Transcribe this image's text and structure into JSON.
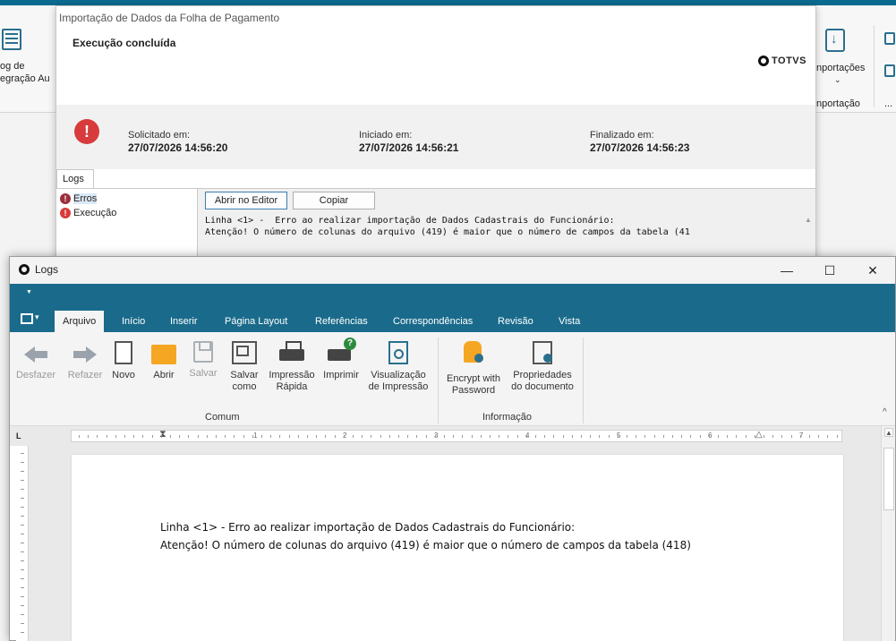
{
  "import_dialog": {
    "title": "Importação de Dados da Folha de Pagamento",
    "status": "Execução concluída",
    "brand": "TOTVS",
    "requested_label": "Solicitado em:",
    "requested_value": "27/07/2026 14:56:20",
    "started_label": "Iniciado em:",
    "started_value": "27/07/2026 14:56:21",
    "finished_label": "Finalizado em:",
    "finished_value": "27/07/2026 14:56:23",
    "tab_logs": "Logs",
    "tree": [
      "Erros",
      "Execução"
    ],
    "open_editor_label": "Abrir no Editor",
    "copy_label": "Copiar",
    "log_line1": "Linha <1> -  Erro ao realizar importação de Dados Cadastrais do Funcionário:",
    "log_line2": "Atenção! O número de colunas do arquivo (419) é maior que o número de campos da tabela (41"
  },
  "background_app": {
    "left_button_line1": "og de",
    "left_button_line2": "egração  Au",
    "right_button_label": "nportações",
    "right_group_label": "nportação",
    "more": "..."
  },
  "logs_window": {
    "title": "Logs",
    "minimize": "—",
    "maximize": "☐",
    "close": "✕",
    "tabs": [
      "Arquivo",
      "Início",
      "Inserir",
      "Página Layout",
      "Referências",
      "Correspondências",
      "Revisão",
      "Vista"
    ],
    "buttons": {
      "undo": "Desfazer",
      "redo": "Refazer",
      "new": "Novo",
      "open": "Abrir",
      "save": "Salvar",
      "save_as_1": "Salvar",
      "save_as_2": "como",
      "quick_print_1": "Impressão",
      "quick_print_2": "Rápida",
      "print": "Imprimir",
      "preview_1": "Visualização",
      "preview_2": "de Impressão",
      "encrypt_1": "Encrypt with",
      "encrypt_2": "Password",
      "props_1": "Propriedades",
      "props_2": "do documento"
    },
    "group_common": "Comum",
    "group_info": "Informação",
    "ruler_numbers": [
      "1",
      "2",
      "3",
      "4",
      "5",
      "6",
      "7"
    ],
    "document_line1": "Linha <1> -  Erro ao realizar importação de Dados Cadastrais do Funcionário:",
    "document_line2": "Atenção! O número de colunas do arquivo (419) é maior que o número de campos da tabela (418)"
  },
  "colors": {
    "accent": "#1a6b8b",
    "error": "#d83b3b"
  }
}
